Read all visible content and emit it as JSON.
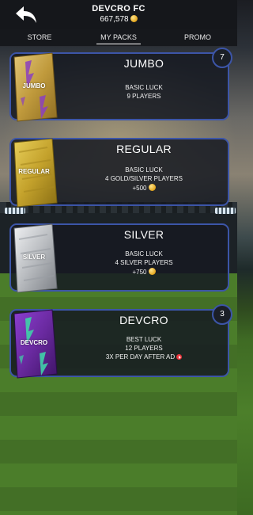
{
  "header": {
    "club_name": "DEVCRO FC",
    "coins": "667,578",
    "coin_icon": "coin-bag-icon",
    "back_icon": "back-arrow-icon"
  },
  "tabs": [
    {
      "label": "STORE",
      "active": false
    },
    {
      "label": "MY PACKS",
      "active": true
    },
    {
      "label": "PROMO",
      "active": false
    }
  ],
  "colors": {
    "card_border": "#3c55a8",
    "jumbo": "#c9a64a",
    "regular": "#c4a22c",
    "silver": "#b9bcc0",
    "devcro": "#6a2aa0",
    "accent_pattern": "#8b3fbf"
  },
  "packs": [
    {
      "art_label": "JUMBO",
      "title": "JUMBO",
      "luck": "BASIC LUCK",
      "players": "9 PLAYERS",
      "extra": "",
      "badge": "7"
    },
    {
      "art_label": "REGULAR",
      "title": "REGULAR",
      "luck": "BASIC LUCK",
      "players": "4 GOLD/SILVER PLAYERS",
      "extra": "+500",
      "badge": ""
    },
    {
      "art_label": "SILVER",
      "title": "SILVER",
      "luck": "BASIC LUCK",
      "players": "4  SILVER PLAYERS",
      "extra": "+750",
      "badge": ""
    },
    {
      "art_label": "DEVCRO",
      "title": "DEVCRO",
      "luck": "BEST LUCK",
      "players": "12 PLAYERS",
      "extra": "3X PER DAY AFTER AD",
      "badge": "3"
    }
  ]
}
